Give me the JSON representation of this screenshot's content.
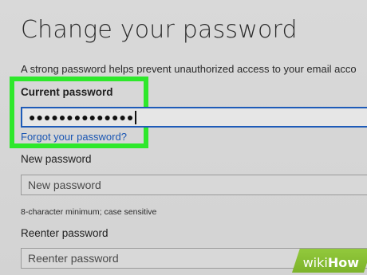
{
  "page": {
    "title": "Change your password",
    "description": "A strong password helps prevent unauthorized access to your email acco"
  },
  "current_password": {
    "label": "Current password",
    "value": "●●●●●●●●●●●●●●",
    "forgot_link": "Forgot your password?"
  },
  "new_password": {
    "label": "New password",
    "placeholder": "New password",
    "hint": "8-character minimum; case sensitive"
  },
  "reenter_password": {
    "label": "Reenter password",
    "placeholder": "Reenter password"
  },
  "watermark": {
    "wiki": "wiki",
    "how": "How"
  },
  "colors": {
    "highlight": "#2ee82b",
    "focus_border": "#1e5bb8",
    "link": "#1a56b3",
    "watermark": "#8bc13a"
  }
}
